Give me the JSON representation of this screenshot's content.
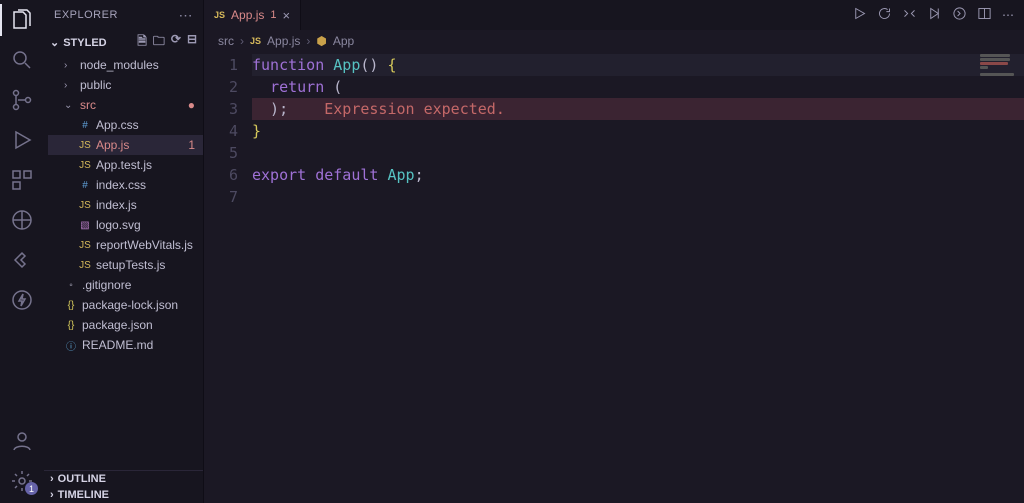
{
  "sidebar": {
    "title": "EXPLORER",
    "project": "STYLED",
    "bottom_sections": [
      "OUTLINE",
      "TIMELINE"
    ],
    "tree": [
      {
        "type": "folder",
        "label": "node_modules",
        "depth": 1,
        "open": false
      },
      {
        "type": "folder",
        "label": "public",
        "depth": 1,
        "open": false
      },
      {
        "type": "folder",
        "label": "src",
        "depth": 1,
        "open": true,
        "error": true
      },
      {
        "type": "file",
        "label": "App.css",
        "depth": 2,
        "icon": "#",
        "iconcls": "col-css"
      },
      {
        "type": "file",
        "label": "App.js",
        "depth": 2,
        "icon": "JS",
        "iconcls": "col-js",
        "active": true,
        "error": true,
        "badge": "1"
      },
      {
        "type": "file",
        "label": "App.test.js",
        "depth": 2,
        "icon": "JS",
        "iconcls": "col-js"
      },
      {
        "type": "file",
        "label": "index.css",
        "depth": 2,
        "icon": "#",
        "iconcls": "col-css"
      },
      {
        "type": "file",
        "label": "index.js",
        "depth": 2,
        "icon": "JS",
        "iconcls": "col-js"
      },
      {
        "type": "file",
        "label": "logo.svg",
        "depth": 2,
        "icon": "▧",
        "iconcls": "col-svg"
      },
      {
        "type": "file",
        "label": "reportWebVitals.js",
        "depth": 2,
        "icon": "JS",
        "iconcls": "col-js"
      },
      {
        "type": "file",
        "label": "setupTests.js",
        "depth": 2,
        "icon": "JS",
        "iconcls": "col-js"
      },
      {
        "type": "file",
        "label": ".gitignore",
        "depth": 1,
        "icon": "◦",
        "iconcls": ""
      },
      {
        "type": "file",
        "label": "package-lock.json",
        "depth": 1,
        "icon": "{}",
        "iconcls": "col-json"
      },
      {
        "type": "file",
        "label": "package.json",
        "depth": 1,
        "icon": "{}",
        "iconcls": "col-json"
      },
      {
        "type": "file",
        "label": "README.md",
        "depth": 1,
        "icon": "ⓘ",
        "iconcls": "col-md"
      }
    ]
  },
  "tabs": {
    "open": [
      {
        "label": "App.js",
        "errors": "1"
      }
    ]
  },
  "breadcrumb": {
    "parts": [
      "src",
      "App.js",
      "App"
    ],
    "file_icon": "JS",
    "symbol_icon": "⬢"
  },
  "editor": {
    "lines": [
      {
        "n": "1",
        "hl": true,
        "tokens": [
          [
            "kw",
            "function "
          ],
          [
            "fn",
            "App"
          ],
          [
            "pn",
            "() "
          ],
          [
            "br",
            "{"
          ]
        ]
      },
      {
        "n": "2",
        "tokens": [
          [
            "pn",
            "  "
          ],
          [
            "kw",
            "return"
          ],
          [
            "pn",
            " ("
          ]
        ]
      },
      {
        "n": "3",
        "err": true,
        "tokens": [
          [
            "pn",
            "  );    "
          ],
          [
            "er",
            "Expression expected."
          ]
        ]
      },
      {
        "n": "4",
        "tokens": [
          [
            "br",
            "}"
          ]
        ]
      },
      {
        "n": "5",
        "tokens": []
      },
      {
        "n": "6",
        "tokens": [
          [
            "kw",
            "export "
          ],
          [
            "kw",
            "default "
          ],
          [
            "fn",
            "App"
          ],
          [
            "pn",
            ";"
          ]
        ]
      },
      {
        "n": "7",
        "tokens": []
      }
    ]
  },
  "activity": {
    "settings_badge": "1"
  }
}
